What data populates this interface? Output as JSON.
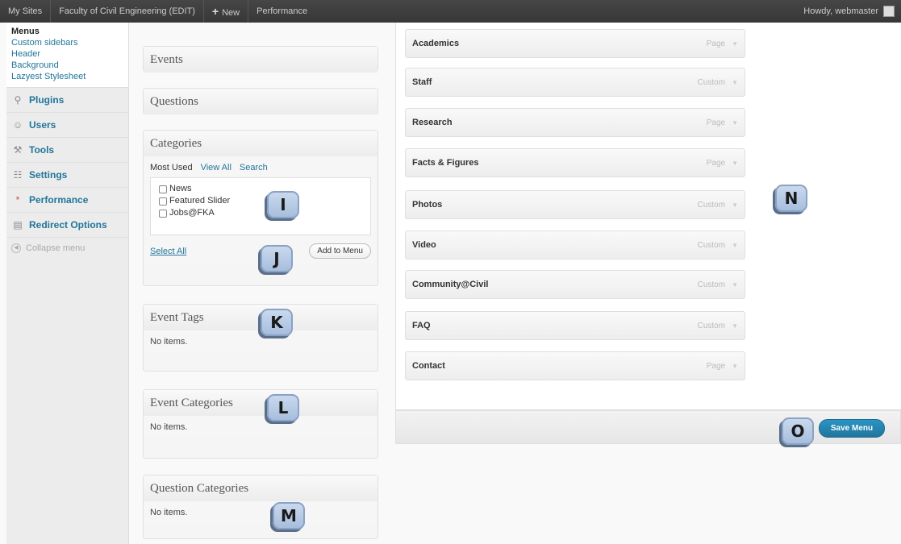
{
  "adminbar": {
    "my_sites": "My Sites",
    "site_name": "Faculty of Civil Engineering (EDIT)",
    "new_label": "New",
    "performance": "Performance",
    "howdy": "Howdy, webmaster"
  },
  "sidebar": {
    "submenu_title": "Menus",
    "submenu_items": [
      "Custom sidebars",
      "Header",
      "Background",
      "Lazyest Stylesheet"
    ],
    "items": [
      {
        "label": "Plugins",
        "icon": "plugin-icon"
      },
      {
        "label": "Users",
        "icon": "users-icon"
      },
      {
        "label": "Tools",
        "icon": "tools-icon"
      },
      {
        "label": "Settings",
        "icon": "settings-icon"
      },
      {
        "label": "Performance",
        "icon": "performance-icon"
      },
      {
        "label": "Redirect Options",
        "icon": "redirect-icon"
      }
    ],
    "collapse": "Collapse menu"
  },
  "boxes": {
    "events": "Events",
    "questions": "Questions",
    "categories": {
      "title": "Categories",
      "tabs": [
        "Most Used",
        "View All",
        "Search"
      ],
      "options": [
        "News",
        "Featured Slider",
        "Jobs@FKA"
      ],
      "select_all": "Select All",
      "add_button": "Add to Menu"
    },
    "event_tags": {
      "title": "Event Tags",
      "empty": "No items."
    },
    "event_categories": {
      "title": "Event Categories",
      "empty": "No items."
    },
    "question_categories": {
      "title": "Question Categories",
      "empty": "No items."
    }
  },
  "markers": [
    "I",
    "J",
    "K",
    "L",
    "M",
    "N",
    "O"
  ],
  "menu_items": [
    {
      "title": "Academics",
      "type": "Page"
    },
    {
      "title": "Staff",
      "type": "Custom"
    },
    {
      "title": "Research",
      "type": "Page"
    },
    {
      "title": "Facts & Figures",
      "type": "Page"
    },
    {
      "title": "Photos",
      "type": "Custom"
    },
    {
      "title": "Video",
      "type": "Custom"
    },
    {
      "title": "Community@Civil",
      "type": "Custom"
    },
    {
      "title": "FAQ",
      "type": "Custom"
    },
    {
      "title": "Contact",
      "type": "Page"
    }
  ],
  "save_button": "Save Menu"
}
